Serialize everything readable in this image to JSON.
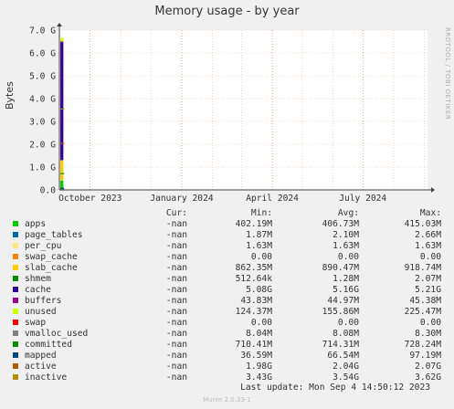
{
  "chart_data": {
    "type": "area",
    "title": "Memory usage - by year",
    "ylabel": "Bytes",
    "xlabel": "",
    "watermark": "RRDTOOL / TOBI OETIKER",
    "ylim": [
      0,
      7000000000
    ],
    "y_ticks": [
      "0.0",
      "1.0 G",
      "2.0 G",
      "3.0 G",
      "4.0 G",
      "5.0 G",
      "6.0 G",
      "7.0 G"
    ],
    "y_tick_values": [
      0,
      1000000000,
      2000000000,
      3000000000,
      4000000000,
      5000000000,
      6000000000,
      7000000000
    ],
    "x_ticks": [
      "October 2023",
      "January 2024",
      "April 2024",
      "July 2024"
    ],
    "x_range": [
      "2023-08-31",
      "2024-09-04"
    ],
    "x_tick_dates": [
      "2023-10-01",
      "2024-01-01",
      "2024-04-01",
      "2024-07-01"
    ],
    "data_window": [
      "2023-09-01",
      "2023-09-04"
    ],
    "grid": true,
    "stack_order": [
      "apps",
      "page_tables",
      "per_cpu",
      "swap_cache",
      "slab_cache",
      "shmem",
      "cache",
      "buffers",
      "unused"
    ],
    "line_series": [
      "swap",
      "vmalloc_used",
      "committed",
      "mapped",
      "active",
      "inactive"
    ],
    "headers": {
      "cur": "Cur:",
      "min": "Min:",
      "avg": "Avg:",
      "max": "Max:"
    },
    "series": [
      {
        "name": "apps",
        "color": "#00cc00",
        "cur": "-nan",
        "min": "402.19M",
        "avg": "406.73M",
        "max": "415.03M",
        "value": 406730000
      },
      {
        "name": "page_tables",
        "color": "#0066b3",
        "cur": "-nan",
        "min": "1.87M",
        "avg": "2.10M",
        "max": "2.66M",
        "value": 2100000
      },
      {
        "name": "per_cpu",
        "color": "#ffe680",
        "cur": "-nan",
        "min": "1.63M",
        "avg": "1.63M",
        "max": "1.63M",
        "value": 1630000
      },
      {
        "name": "swap_cache",
        "color": "#ff8000",
        "cur": "-nan",
        "min": "0.00",
        "avg": "0.00",
        "max": "0.00",
        "value": 0
      },
      {
        "name": "slab_cache",
        "color": "#ffcc00",
        "cur": "-nan",
        "min": "862.35M",
        "avg": "890.47M",
        "max": "918.74M",
        "value": 890470000
      },
      {
        "name": "shmem",
        "color": "#008f00",
        "cur": "-nan",
        "min": "512.64k",
        "avg": "1.28M",
        "max": "2.07M",
        "value": 1280000
      },
      {
        "name": "cache",
        "color": "#330099",
        "cur": "-nan",
        "min": "5.08G",
        "avg": "5.16G",
        "max": "5.21G",
        "value": 5160000000
      },
      {
        "name": "buffers",
        "color": "#990099",
        "cur": "-nan",
        "min": "43.83M",
        "avg": "44.97M",
        "max": "45.38M",
        "value": 44970000
      },
      {
        "name": "unused",
        "color": "#ccff00",
        "cur": "-nan",
        "min": "124.37M",
        "avg": "155.86M",
        "max": "225.47M",
        "value": 155860000
      },
      {
        "name": "swap",
        "color": "#ff0000",
        "cur": "-nan",
        "min": "0.00",
        "avg": "0.00",
        "max": "0.00",
        "value": 0
      },
      {
        "name": "vmalloc_used",
        "color": "#808080",
        "cur": "-nan",
        "min": "8.04M",
        "avg": "8.08M",
        "max": "8.30M",
        "value": 8080000
      },
      {
        "name": "committed",
        "color": "#008f00",
        "cur": "-nan",
        "min": "710.41M",
        "avg": "714.31M",
        "max": "728.24M",
        "value": 714310000
      },
      {
        "name": "mapped",
        "color": "#00487d",
        "cur": "-nan",
        "min": "36.59M",
        "avg": "66.54M",
        "max": "97.19M",
        "value": 66540000
      },
      {
        "name": "active",
        "color": "#b35a00",
        "cur": "-nan",
        "min": "1.98G",
        "avg": "2.04G",
        "max": "2.07G",
        "value": 2040000000
      },
      {
        "name": "inactive",
        "color": "#b38f00",
        "cur": "-nan",
        "min": "3.43G",
        "avg": "3.54G",
        "max": "3.62G",
        "value": 3540000000
      }
    ],
    "last_update": "Last update:  Mon Sep  4 14:50:12 2023",
    "footer": "Munin 2.0.33-1"
  }
}
